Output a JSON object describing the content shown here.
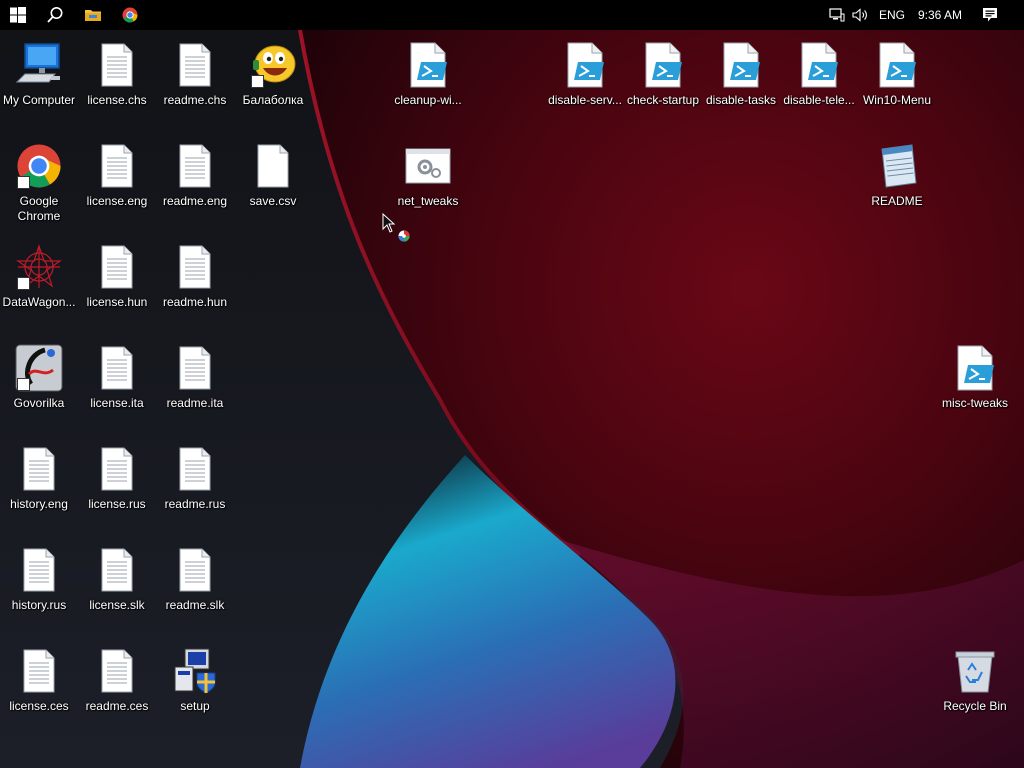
{
  "taskbar": {
    "start_icon": "windows-logo-icon",
    "search_icon": "search-icon",
    "explorer_icon": "folder-icon",
    "chrome_icon": "chrome-icon",
    "tray": {
      "network_icon": "network-icon",
      "volume_icon": "volume-icon",
      "language": "ENG",
      "time": "9:36 AM",
      "notifications_icon": "action-center-icon"
    }
  },
  "desktop": {
    "icons": [
      {
        "label": "My Computer",
        "icon": "computer-icon"
      },
      {
        "label": "license.chs",
        "icon": "document-icon"
      },
      {
        "label": "readme.chs",
        "icon": "document-icon"
      },
      {
        "label": "Балаболка",
        "icon": "balabolka-icon"
      },
      {
        "label": "Google Chrome",
        "icon": "chrome-icon"
      },
      {
        "label": "license.eng",
        "icon": "document-icon"
      },
      {
        "label": "readme.eng",
        "icon": "document-icon"
      },
      {
        "label": "save.csv",
        "icon": "blank-file-icon"
      },
      {
        "label": "DataWagon...",
        "icon": "datawagon-icon"
      },
      {
        "label": "license.hun",
        "icon": "document-icon"
      },
      {
        "label": "readme.hun",
        "icon": "document-icon"
      },
      {
        "label": "Govorilka",
        "icon": "govorilka-icon"
      },
      {
        "label": "license.ita",
        "icon": "document-icon"
      },
      {
        "label": "readme.ita",
        "icon": "document-icon"
      },
      {
        "label": "history.eng",
        "icon": "document-icon"
      },
      {
        "label": "license.rus",
        "icon": "document-icon"
      },
      {
        "label": "readme.rus",
        "icon": "document-icon"
      },
      {
        "label": "history.rus",
        "icon": "document-icon"
      },
      {
        "label": "license.slk",
        "icon": "document-icon"
      },
      {
        "label": "readme.slk",
        "icon": "document-icon"
      },
      {
        "label": "license.ces",
        "icon": "document-icon"
      },
      {
        "label": "readme.ces",
        "icon": "document-icon"
      },
      {
        "label": "setup",
        "icon": "installer-icon"
      },
      {
        "label": "cleanup-wi...",
        "icon": "powershell-script-icon"
      },
      {
        "label": "net_tweaks",
        "icon": "settings-file-icon"
      },
      {
        "label": "disable-serv...",
        "icon": "powershell-script-icon"
      },
      {
        "label": "check-startup",
        "icon": "powershell-script-icon"
      },
      {
        "label": "disable-tasks",
        "icon": "powershell-script-icon"
      },
      {
        "label": "disable-tele...",
        "icon": "powershell-script-icon"
      },
      {
        "label": "Win10-Menu",
        "icon": "powershell-script-icon"
      },
      {
        "label": "README",
        "icon": "notepad-icon"
      },
      {
        "label": "misc-tweaks",
        "icon": "powershell-script-icon"
      },
      {
        "label": "Recycle Bin",
        "icon": "recycle-bin-icon"
      }
    ]
  },
  "colors": {
    "taskbar": "#000000",
    "wallpaper_red": "#8a0a1e",
    "wallpaper_cyan": "#1bb5d6",
    "wallpaper_dark": "#12141b"
  }
}
